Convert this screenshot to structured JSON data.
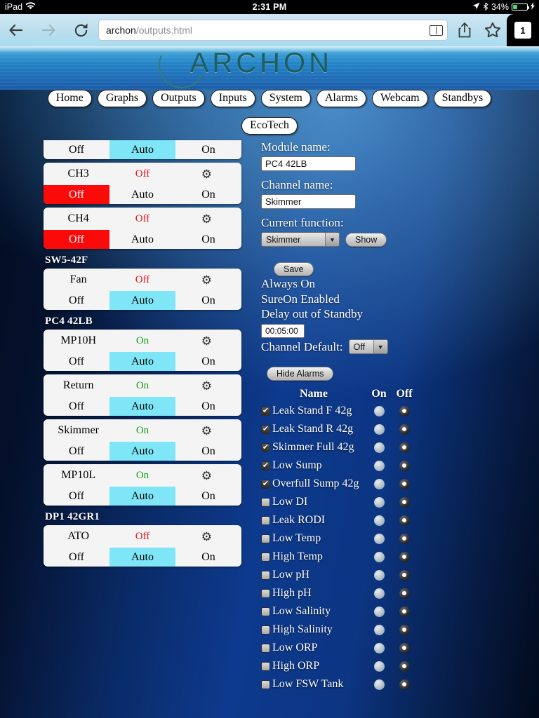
{
  "statusbar": {
    "device": "iPad",
    "wifi_icon": "wifi-icon",
    "time": "2:31 PM",
    "location_icon": "location-arrow-icon",
    "bluetooth_icon": "bluetooth-icon",
    "battery_percent": "34%",
    "charging_icon": "lightning-bolt-icon"
  },
  "browser": {
    "back_icon": "back-arrow-icon",
    "forward_icon": "forward-arrow-icon",
    "reload_icon": "reload-icon",
    "url_host": "archon",
    "url_path": "/outputs.html",
    "reader_icon": "reader-view-icon",
    "share_icon": "share-icon",
    "bookmark_icon": "bookmark-star-icon",
    "tab_count": "1"
  },
  "site": {
    "logo_text": "ARCHON",
    "nav_primary": [
      "Home",
      "Graphs",
      "Outputs",
      "Inputs",
      "System",
      "Alarms",
      "Webcam",
      "Standbys"
    ],
    "nav_secondary": [
      "EcoTech"
    ]
  },
  "outputs": {
    "button_labels": {
      "off": "Off",
      "auto": "Auto",
      "on": "On"
    },
    "gear_icon": "gear-icon",
    "groups": [
      {
        "label": null,
        "channels": [
          {
            "name": null,
            "state": null,
            "state_class": null,
            "selected": "auto",
            "clipped": true
          }
        ]
      },
      {
        "label": null,
        "channels": [
          {
            "name": "CH3",
            "state": "Off",
            "state_class": "off",
            "selected": "off"
          },
          {
            "name": "CH4",
            "state": "Off",
            "state_class": "off",
            "selected": "off"
          }
        ]
      },
      {
        "label": "SW5-42F",
        "channels": [
          {
            "name": "Fan",
            "state": "Off",
            "state_class": "off",
            "selected": "auto"
          }
        ]
      },
      {
        "label": "PC4 42LB",
        "channels": [
          {
            "name": "MP10H",
            "state": "On",
            "state_class": "on",
            "selected": "auto"
          },
          {
            "name": "Return",
            "state": "On",
            "state_class": "on",
            "selected": "auto"
          },
          {
            "name": "Skimmer",
            "state": "On",
            "state_class": "on",
            "selected": "auto"
          },
          {
            "name": "MP10L",
            "state": "On",
            "state_class": "on",
            "selected": "auto"
          }
        ]
      },
      {
        "label": "DP1 42GR1",
        "channels": [
          {
            "name": "ATO",
            "state": "Off",
            "state_class": "off",
            "selected": "auto"
          }
        ]
      }
    ]
  },
  "detail": {
    "module_name_label": "Module name:",
    "module_name_value": "PC4 42LB",
    "channel_name_label": "Channel name:",
    "channel_name_value": "Skimmer",
    "current_function_label": "Current function:",
    "current_function_value": "Skimmer",
    "show_button": "Show",
    "save_button": "Save",
    "always_on": "Always On",
    "sure_on": "SureOn Enabled",
    "delay_label": "Delay out of Standby",
    "delay_value": "00:05:00",
    "channel_default_label": "Channel Default:",
    "channel_default_value": "Off",
    "hide_alarms_button": "Hide Alarms",
    "dropdown_icon": "chevron-down-icon"
  },
  "alarms": {
    "header": {
      "name": "Name",
      "on": "On",
      "off": "Off"
    },
    "rows": [
      {
        "name": "Leak Stand F 42g",
        "enabled": true,
        "trigger": "off"
      },
      {
        "name": "Leak Stand R 42g",
        "enabled": true,
        "trigger": "off"
      },
      {
        "name": "Skimmer Full 42g",
        "enabled": true,
        "trigger": "off"
      },
      {
        "name": "Low Sump",
        "enabled": true,
        "trigger": "off"
      },
      {
        "name": "Overfull Sump 42g",
        "enabled": true,
        "trigger": "off"
      },
      {
        "name": "Low DI",
        "enabled": false,
        "trigger": "off"
      },
      {
        "name": "Leak RODI",
        "enabled": false,
        "trigger": "off"
      },
      {
        "name": "Low Temp",
        "enabled": false,
        "trigger": "off"
      },
      {
        "name": "High Temp",
        "enabled": false,
        "trigger": "off"
      },
      {
        "name": "Low pH",
        "enabled": false,
        "trigger": "off"
      },
      {
        "name": "High pH",
        "enabled": false,
        "trigger": "off"
      },
      {
        "name": "Low Salinity",
        "enabled": false,
        "trigger": "off"
      },
      {
        "name": "High Salinity",
        "enabled": false,
        "trigger": "off"
      },
      {
        "name": "Low ORP",
        "enabled": false,
        "trigger": "off"
      },
      {
        "name": "High ORP",
        "enabled": false,
        "trigger": "off"
      },
      {
        "name": "Low FSW Tank",
        "enabled": false,
        "trigger": "off"
      }
    ]
  },
  "colors": {
    "selected_auto": "#7ee6f7",
    "selected_off": "#fb0a0a",
    "state_on": "#13a013",
    "state_off": "#e01b1b",
    "page_blue": "#0d3a8e"
  }
}
